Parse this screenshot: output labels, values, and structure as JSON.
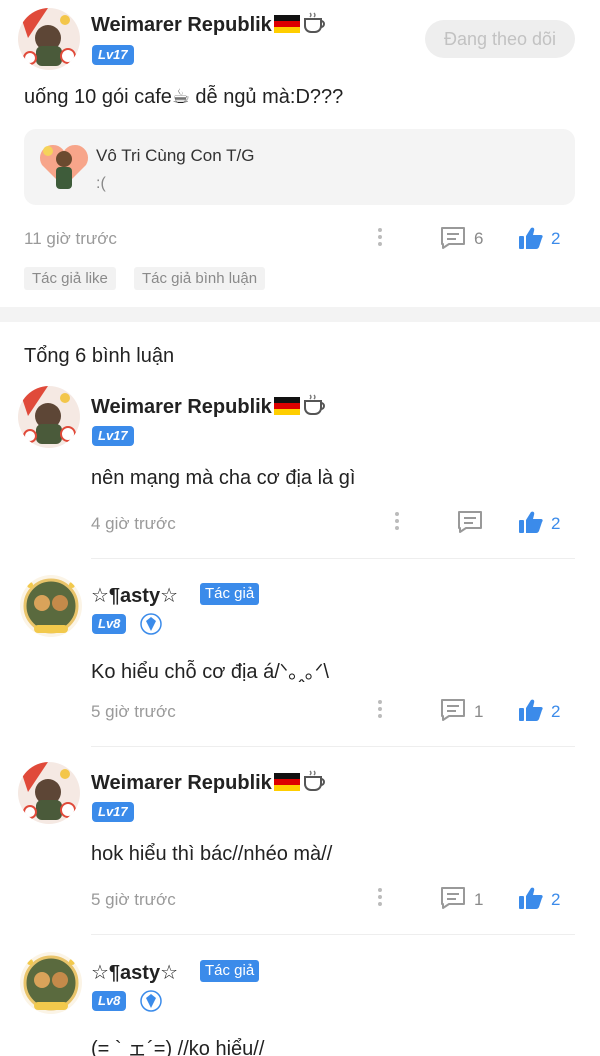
{
  "post": {
    "author": {
      "name": "Weimarer Republik",
      "level": "Lv17"
    },
    "follow_label": "Đang theo dõi",
    "text": "uống 10 gói cafe☕ dễ ngủ mà:D???",
    "quote": {
      "title": "Vô Tri Cùng Con T/G",
      "subtitle": ":("
    },
    "time": "11 giờ trước",
    "comment_count": "6",
    "like_count": "2",
    "tags": [
      "Tác giả like",
      "Tác giả bình luận"
    ]
  },
  "comments_header": "Tổng 6 bình luận",
  "comments": [
    {
      "name": "Weimarer Republik",
      "level": "Lv17",
      "author_badge": "",
      "text": "nên mạng mà cha cơ địa là gì",
      "time": "4 giờ trước",
      "reply_count": "",
      "like_count": "2"
    },
    {
      "name": "☆¶asty☆",
      "level": "Lv8",
      "author_badge": "Tác giả",
      "text": "Ko hiểu chỗ cơ địa á/ᐠ｡ꞈ｡ᐟ\\",
      "time": "5 giờ trước",
      "reply_count": "1",
      "like_count": "2"
    },
    {
      "name": "Weimarer Republik",
      "level": "Lv17",
      "author_badge": "",
      "text": "hok hiểu thì bác//nhéo mà//",
      "time": "5 giờ trước",
      "reply_count": "1",
      "like_count": "2"
    },
    {
      "name": "☆¶asty☆",
      "level": "Lv8",
      "author_badge": "Tác giả",
      "text": "(= ` ェ´=) //ko hiểu//",
      "time": "",
      "reply_count": "",
      "like_count": ""
    }
  ],
  "colors": {
    "accent": "#3b8bea",
    "muted": "#9a9a9a",
    "band": "#f3f3f3"
  },
  "icons": [
    "avatar",
    "germany-flag-icon",
    "coffee-icon",
    "more-icon",
    "comment-icon",
    "thumbs-up-icon",
    "shield-badge-icon"
  ]
}
